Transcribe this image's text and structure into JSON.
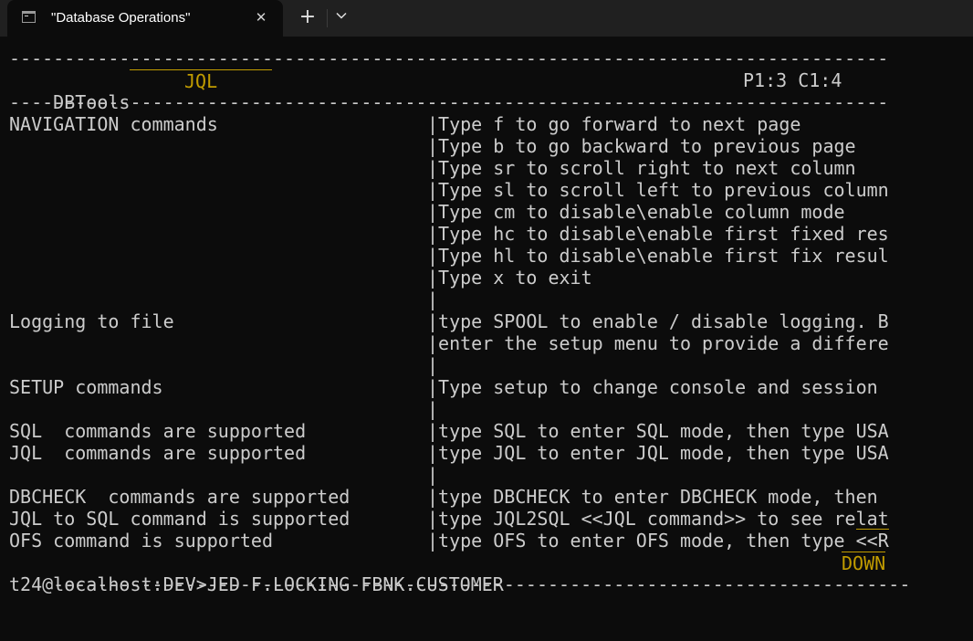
{
  "window": {
    "tab_title": "\"Database Operations\"",
    "close_symbol": "✕",
    "new_tab_symbol": "+",
    "icons": {
      "app": "terminal-icon",
      "close": "close-icon",
      "new_tab": "plus-icon",
      "dropdown": "chevron-down-icon"
    }
  },
  "colors": {
    "background": "#0c0c0c",
    "titlebar": "#202020",
    "text": "#cccccc",
    "accent": "#c19c00"
  },
  "terminal": {
    "separator_top": "--------------------------------------------------------------------------------",
    "header": {
      "app_name": "DBTools",
      "mode": "JQL",
      "position": "P1:3 C1:4"
    },
    "separator_mid": "--------------------------------------------------------------------------------",
    "rows": [
      {
        "left": "NAVIGATION commands",
        "right": "|Type f to go forward to next page"
      },
      {
        "left": "",
        "right": "|Type b to go backward to previous page"
      },
      {
        "left": "",
        "right": "|Type sr to scroll right to next column"
      },
      {
        "left": "",
        "right": "|Type sl to scroll left to previous column"
      },
      {
        "left": "",
        "right": "|Type cm to disable\\enable column mode"
      },
      {
        "left": "",
        "right": "|Type hc to disable\\enable first fixed res"
      },
      {
        "left": "",
        "right": "|Type hl to disable\\enable first fix resul"
      },
      {
        "left": "",
        "right": "|Type x to exit"
      },
      {
        "left": "",
        "right": "|"
      },
      {
        "left": "Logging to file",
        "right": "|type SPOOL to enable / disable logging. B"
      },
      {
        "left": "",
        "right": "|enter the setup menu to provide a differe"
      },
      {
        "left": "",
        "right": "|"
      },
      {
        "left": "SETUP commands",
        "right": "|Type setup to change console and session"
      },
      {
        "left": "",
        "right": "|"
      },
      {
        "left": "SQL  commands are supported",
        "right": "|type SQL to enter SQL mode, then type USA"
      },
      {
        "left": "JQL  commands are supported",
        "right": "|type JQL to enter JQL mode, then type USA"
      },
      {
        "left": "",
        "right": "|"
      },
      {
        "left": "DBCHECK  commands are supported",
        "right": "|type DBCHECK to enter DBCHECK mode, then"
      },
      {
        "left": "JQL to SQL command is supported",
        "right": "|type JQL2SQL <<JQL command>> to see relat"
      },
      {
        "left": "OFS command is supported",
        "right_prefix": "|type OFS to enter OFS mode, then type ",
        "right_link": "<<R"
      }
    ],
    "footer_separator": "------------------------------------------------------------------------------",
    "footer_indicator": "DOWN",
    "prompt": "t24@localhost:DEV>JED F.LOCKING FBNK.CUSTOMER"
  }
}
